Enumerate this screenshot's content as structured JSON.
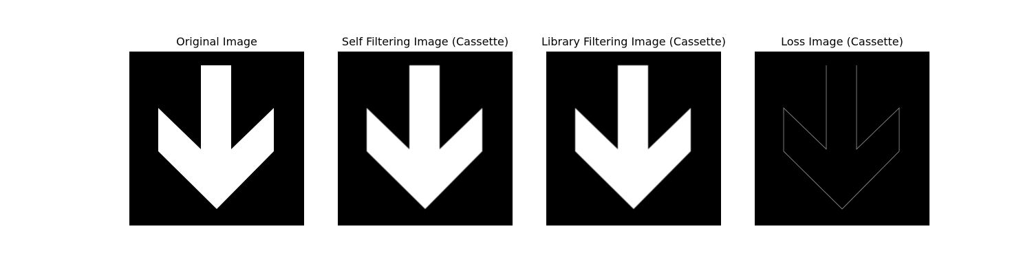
{
  "panels": [
    {
      "title": "Original Image",
      "image": "down-arrow-original"
    },
    {
      "title": "Self Filtering Image (Cassette)",
      "image": "down-arrow-self-filtered"
    },
    {
      "title": "Library Filtering Image (Cassette)",
      "image": "down-arrow-library-filtered"
    },
    {
      "title": "Loss Image (Cassette)",
      "image": "down-arrow-loss-edges"
    }
  ],
  "colors": {
    "background": "#000000",
    "arrow": "#ffffff",
    "loss_edge": "#8a8a8a",
    "figure_background": "#ffffff"
  }
}
